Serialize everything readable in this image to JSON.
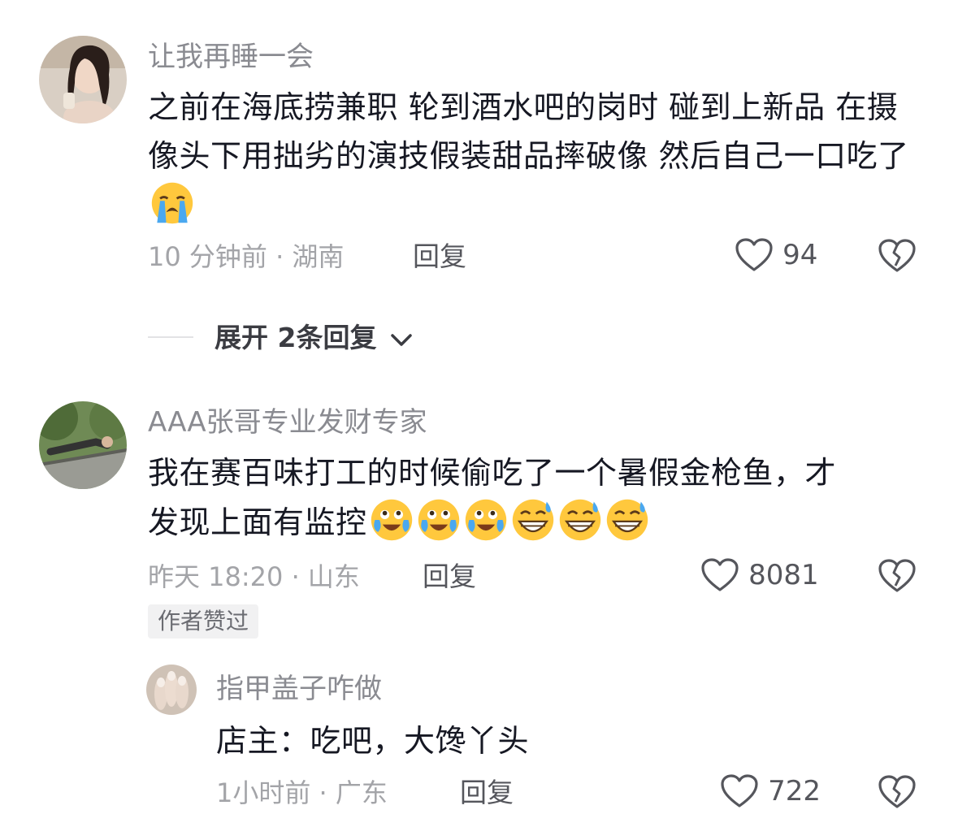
{
  "comments": [
    {
      "username": "让我再睡一会",
      "text": "之前在海底捞兼职 轮到酒水吧的岗时 碰到上新品 在摄像头下用拙劣的演技假装甜品摔破像 然后自己一口吃了",
      "emojis": [
        "loudly-crying-emoji"
      ],
      "time": "10 分钟前 · 湖南",
      "reply_label": "回复",
      "likes": "94",
      "expand_label": "展开 2条回复"
    },
    {
      "username": "AAA张哥专业发财专家",
      "text": "我在赛百味打工的时候偷吃了一个暑假金枪鱼，才发现上面有监控",
      "emojis": [
        "crying-laughing-emoji",
        "crying-laughing-emoji",
        "crying-laughing-emoji",
        "grinning-sweat-emoji",
        "grinning-sweat-emoji",
        "grinning-sweat-emoji"
      ],
      "time": "昨天 18:20 · 山东",
      "reply_label": "回复",
      "likes": "8081",
      "badge": "作者赞过"
    },
    {
      "username": "指甲盖子咋做",
      "text": "店主：吃吧，大馋丫头",
      "time": "1小时前 · 广东",
      "reply_label": "回复",
      "likes": "722"
    }
  ],
  "colors": {
    "meta": "#a3a4a8",
    "username": "#8a8b91",
    "text": "#161823"
  }
}
